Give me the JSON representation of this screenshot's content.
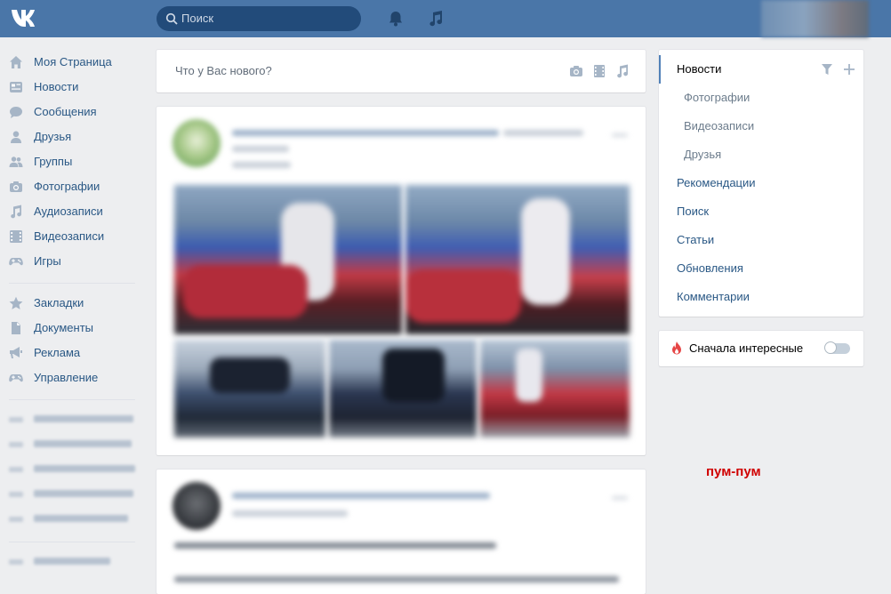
{
  "header": {
    "search_placeholder": "Поиск"
  },
  "leftnav": {
    "items": [
      {
        "label": "Моя Страница",
        "icon": "home-icon"
      },
      {
        "label": "Новости",
        "icon": "news-icon"
      },
      {
        "label": "Сообщения",
        "icon": "messages-icon"
      },
      {
        "label": "Друзья",
        "icon": "friend-icon"
      },
      {
        "label": "Группы",
        "icon": "groups-icon"
      },
      {
        "label": "Фотографии",
        "icon": "camera-icon"
      },
      {
        "label": "Аудиозаписи",
        "icon": "music-icon"
      },
      {
        "label": "Видеозаписи",
        "icon": "video-icon"
      },
      {
        "label": "Игры",
        "icon": "gamepad-icon"
      }
    ],
    "items2": [
      {
        "label": "Закладки",
        "icon": "star-icon"
      },
      {
        "label": "Документы",
        "icon": "document-icon"
      },
      {
        "label": "Реклама",
        "icon": "megaphone-icon"
      },
      {
        "label": "Управление",
        "icon": "gamepad-icon"
      }
    ]
  },
  "composer": {
    "placeholder": "Что у Вас нового?"
  },
  "rightmenu": {
    "items": [
      {
        "label": "Новости",
        "active": true
      },
      {
        "label": "Фотографии",
        "sub": true
      },
      {
        "label": "Видеозаписи",
        "sub": true
      },
      {
        "label": "Друзья",
        "sub": true
      },
      {
        "label": "Рекомендации"
      },
      {
        "label": "Поиск"
      },
      {
        "label": "Статьи"
      },
      {
        "label": "Обновления"
      },
      {
        "label": "Комментарии"
      }
    ]
  },
  "interesting": {
    "label": "Сначала интересные",
    "enabled": false
  },
  "caption": "пум-пум",
  "colors": {
    "header": "#4a76a8",
    "link": "#2a5885",
    "background": "#edeef0",
    "caption": "#d00000"
  }
}
